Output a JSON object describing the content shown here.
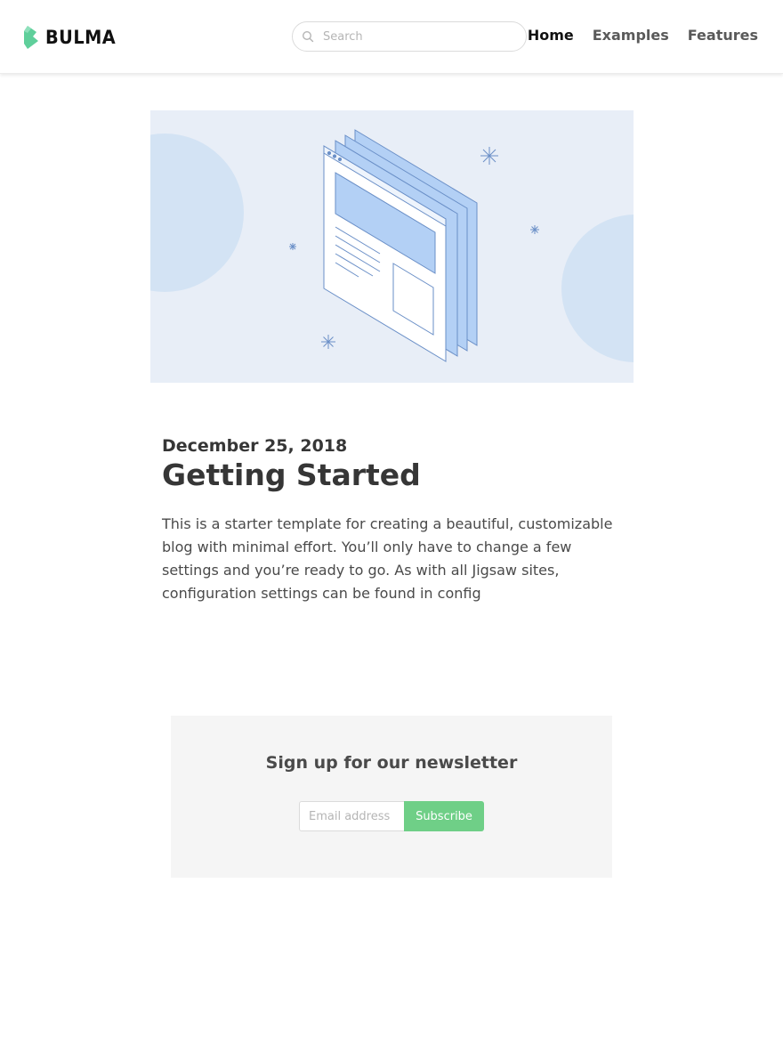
{
  "navbar": {
    "brand": "BULMA",
    "search_placeholder": "Search",
    "links": [
      {
        "label": "Home",
        "active": true
      },
      {
        "label": "Examples",
        "active": false
      },
      {
        "label": "Features",
        "active": false
      }
    ]
  },
  "hero": {
    "icon": "isometric-browser-windows-illustration",
    "colors": {
      "background": "#e8eef7",
      "accent": "#b3d0f5",
      "line": "#6a8fc7"
    }
  },
  "post": {
    "date": "December 25, 2018",
    "title": "Getting Started",
    "excerpt": "This is a starter template for creating a beautiful, customizable blog with minimal effort. You’ll only have to change a few settings and you’re ready to go. As with all Jigsaw sites, configuration settings can be found in config"
  },
  "newsletter": {
    "title": "Sign up for our newsletter",
    "email_placeholder": "Email address",
    "button_label": "Subscribe",
    "button_color": "#6fcf87"
  },
  "colors": {
    "brand": "#00d1b2",
    "text": "#4a4a4a",
    "heading": "#363636"
  }
}
